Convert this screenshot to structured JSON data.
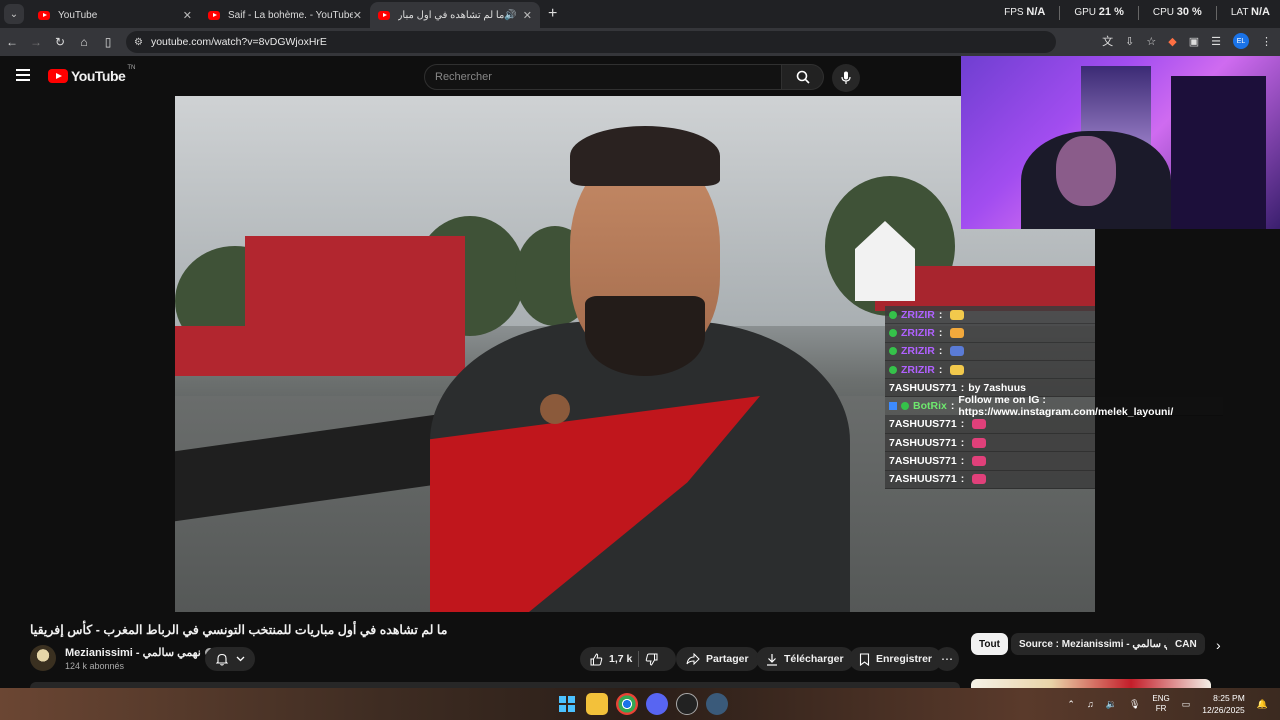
{
  "browser": {
    "tabs": [
      {
        "title": "YouTube",
        "active": false
      },
      {
        "title": "Saif - La bohème. - YouTube",
        "active": false
      },
      {
        "title": "ما لم تشاهده في أول مباريات",
        "active": true,
        "audio": "🔊"
      }
    ],
    "new_tab": "+",
    "url": "youtube.com/watch?v=8vDGWjoxHrE",
    "perf": {
      "fps_label": "FPS",
      "fps_value": "N/A",
      "gpu_label": "GPU",
      "gpu_value": "21 %",
      "cpu_label": "CPU",
      "cpu_value": "30 %",
      "lat_label": "LAT",
      "lat_value": "N/A"
    },
    "profile_initials": "EL"
  },
  "youtube": {
    "logo_text": "YouTube",
    "logo_sup": "TN",
    "search": {
      "placeholder": "Rechercher"
    }
  },
  "chat": [
    {
      "user": "ZRIZIR",
      "sep": " :",
      "message": "",
      "color": "#b061ff",
      "emote_color": "#f2c94c",
      "badge": "green"
    },
    {
      "user": "ZRIZIR",
      "sep": " :",
      "message": "",
      "color": "#b061ff",
      "emote_color": "#f2a93c",
      "badge": "green"
    },
    {
      "user": "ZRIZIR",
      "sep": " :",
      "message": "",
      "color": "#b061ff",
      "emote_color": "#5a7bd6",
      "badge": "green"
    },
    {
      "user": "ZRIZIR",
      "sep": " :",
      "message": "",
      "color": "#b061ff",
      "emote_color": "#f2c94c",
      "badge": "green"
    },
    {
      "user": "7ASHUUS771",
      "sep": " :",
      "message": "by 7ashuus",
      "color": "#ffffff",
      "emote_color": "",
      "badge": ""
    },
    {
      "user": "BotRix",
      "sep": " :",
      "message": "Follow me on IG : https://www.instagram.com/melek_layouni/",
      "color": "#6ee86e",
      "emote_color": "",
      "badge": "bot"
    },
    {
      "user": "7ASHUUS771",
      "sep": " :",
      "message": "",
      "color": "#ffffff",
      "emote_color": "#e0407a",
      "badge": ""
    },
    {
      "user": "7ASHUUS771",
      "sep": " :",
      "message": "",
      "color": "#ffffff",
      "emote_color": "#e0407a",
      "badge": ""
    },
    {
      "user": "7ASHUUS771",
      "sep": " :",
      "message": "",
      "color": "#ffffff",
      "emote_color": "#e0407a",
      "badge": ""
    },
    {
      "user": "7ASHUUS771",
      "sep": " :",
      "message": "",
      "color": "#ffffff",
      "emote_color": "#e0407a",
      "badge": ""
    }
  ],
  "video": {
    "title": "ما لم تشاهده في أول مباريات للمنتخب التونسي في الرباط المغرب - كأس إفريقيا",
    "channel": "Mezianissimi - نهمي سالمي",
    "subscribers": "124 k abonnés",
    "likes": "1,7 k",
    "share_label": "Partager",
    "download_label": "Télécharger",
    "save_label": "Enregistrer",
    "more": "⋯"
  },
  "chips": [
    {
      "label": "Tout",
      "active": true
    },
    {
      "label": "Source : Mezianissimi - نهمي سالمي",
      "active": false
    },
    {
      "label": "CAN",
      "active": false
    }
  ],
  "chip_next": "›",
  "taskbar": {
    "lang_top": "ENG",
    "lang_bottom": "FR",
    "time": "8:25 PM",
    "date": "12/26/2025"
  }
}
